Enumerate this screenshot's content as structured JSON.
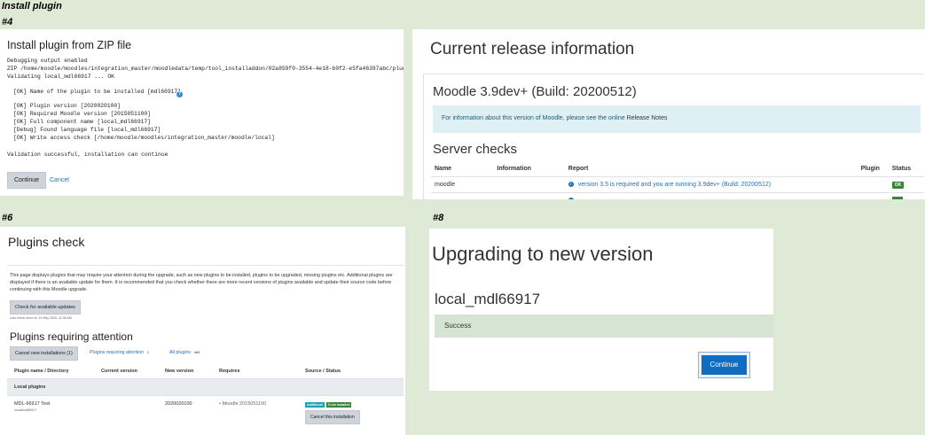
{
  "figure_title": "Install plugin",
  "labels": {
    "p4": "#4",
    "p6": "#6",
    "p8": "#8"
  },
  "panel4": {
    "title": "Install plugin from ZIP file",
    "log_lines": [
      "Debugging output enabled",
      "ZIP /home/moodle/moodles/integration_master/moodledata/temp/tool_installaddon/02a859f0-3554-4e18-b0f2-e5fa46397abc/plugin.zip",
      "Validating local_mdl66917 ... OK"
    ],
    "check_line": "[OK] Name of the plugin to be installed [mdl66917]",
    "check_lines": [
      "[OK] Plugin version [2020020100]",
      "[OK] Required Moodle version [2015051100]",
      "[OK] Full component name [local_mdl66917]",
      "[Debug] Found language file [local_mdl66917]",
      "[OK] Write access check [/home/moodle/moodles/integration_master/moodle/local]"
    ],
    "result": "Validation successful, installation can continue",
    "continue_label": "Continue",
    "cancel_label": "Cancel"
  },
  "release": {
    "title": "Current release information",
    "version": "Moodle 3.9dev+ (Build: 20200512)",
    "info_prefix": "For information about this version of Moodle, please see the online ",
    "info_link": "Release Notes",
    "server_checks": "Server checks",
    "columns": [
      "Name",
      "Information",
      "Report",
      "Plugin",
      "Status"
    ],
    "row": {
      "name": "moodle",
      "information": "",
      "report": "version 3.5 is required and you are running 3.9dev+ (Build: 20200512)",
      "plugin": "",
      "status": "OK"
    }
  },
  "panel6": {
    "title": "Plugins check",
    "description": "This page displays plugins that may require your attention during the upgrade, such as new plugins to be installed, plugins to be upgraded, missing plugins etc. Additional plugins are displayed if there is an available update for them. It is recommended that you check whether there are more recent versions of plugins available and update their source code before continuing with this Moodle upgrade.",
    "check_updates_label": "Check for available updates",
    "last_check": "Last check done on 13 May 2020, 11:38 AM",
    "section_title": "Plugins requiring attention",
    "cancel_new_label": "Cancel new installations (1)",
    "tab_attention": "Plugins requiring attention",
    "tab_attention_count": "1",
    "tab_all": "All plugins",
    "tab_all_count": "469",
    "columns": [
      "Plugin name / Directory",
      "Current version",
      "New version",
      "Requires",
      "Source / Status"
    ],
    "group": "Local plugins",
    "row": {
      "name": "MDL-66917 Test",
      "directory": "/local/mdl66917",
      "current": "",
      "new_version": "2020020100",
      "requires": "Moodle 2015051100",
      "badge_source": "Additional",
      "badge_status": "To be installed",
      "cancel_label": "Cancel this installation"
    }
  },
  "panel8": {
    "title": "Upgrading to new version",
    "plugin": "local_mdl66917",
    "status": "Success",
    "continue_label": "Continue"
  },
  "colors": {
    "background": "#dfead6",
    "primary": "#0f6cbf",
    "ok_badge": "#398439",
    "info_badge": "#17a2b8",
    "success_bg": "#d5e4d3",
    "info_bg": "#dff0f5"
  }
}
